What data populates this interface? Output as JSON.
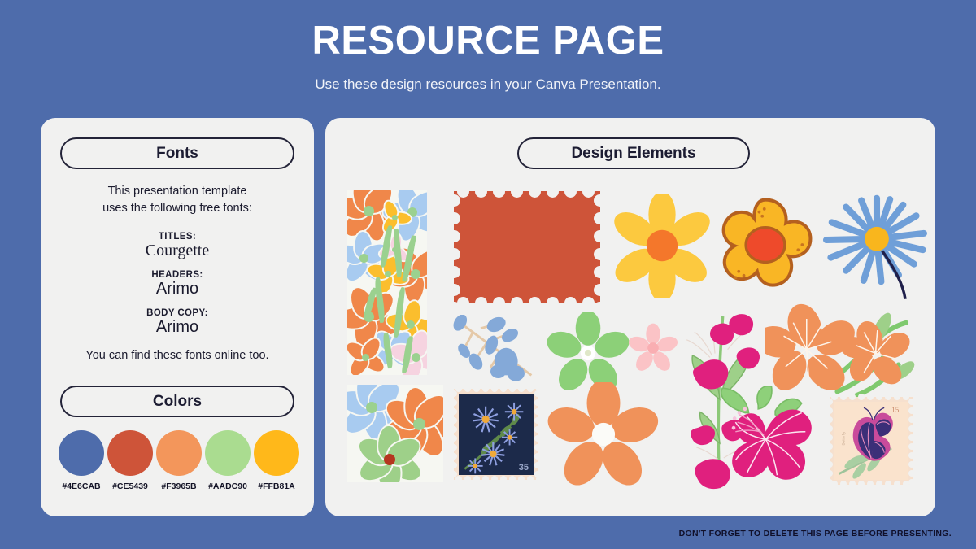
{
  "header": {
    "title": "RESOURCE PAGE",
    "subtitle": "Use these design resources in your Canva Presentation."
  },
  "fonts_panel": {
    "pill_label": "Fonts",
    "intro": "This presentation template\nuses the following free fonts:",
    "titles_label": "TITLES:",
    "titles_value": "Courgette",
    "headers_label": "HEADERS:",
    "headers_value": "Arimo",
    "body_label": "BODY COPY:",
    "body_value": "Arimo",
    "outro": "You can find these fonts online too."
  },
  "colors_panel": {
    "pill_label": "Colors",
    "swatches": [
      {
        "hex": "#4E6CAB",
        "name": "blue"
      },
      {
        "hex": "#CE5439",
        "name": "red"
      },
      {
        "hex": "#F3965B",
        "name": "orange"
      },
      {
        "hex": "#AADC90",
        "name": "green"
      },
      {
        "hex": "#FFB81A",
        "name": "yellow"
      }
    ]
  },
  "elements_panel": {
    "pill_label": "Design Elements",
    "items": [
      {
        "name": "floral-collage-tall",
        "type": "illustration"
      },
      {
        "name": "red-postage-stamp",
        "type": "shape"
      },
      {
        "name": "yellow-daisy-flower",
        "type": "illustration"
      },
      {
        "name": "outlined-yellow-flower",
        "type": "illustration"
      },
      {
        "name": "blue-daisy-flower",
        "type": "illustration"
      },
      {
        "name": "blue-leaf-sprig",
        "type": "illustration"
      },
      {
        "name": "green-flower",
        "type": "illustration"
      },
      {
        "name": "small-pink-flower",
        "type": "illustration"
      },
      {
        "name": "magenta-flower-stem",
        "type": "illustration"
      },
      {
        "name": "orange-flower-pair",
        "type": "illustration"
      },
      {
        "name": "floral-tile-square",
        "type": "illustration"
      },
      {
        "name": "aster-vintage-stamp",
        "type": "illustration",
        "label": "35"
      },
      {
        "name": "large-orange-flower",
        "type": "illustration"
      },
      {
        "name": "magenta-hibiscus",
        "type": "illustration"
      },
      {
        "name": "butterfly-vintage-stamp",
        "type": "illustration",
        "label": "15"
      }
    ]
  },
  "footer": {
    "note": "DON'T FORGET TO DELETE THIS PAGE BEFORE PRESENTING."
  },
  "theme": {
    "background": "#4E6CAB",
    "panel": "#F1F1F0",
    "ink": "#1C1C32"
  }
}
